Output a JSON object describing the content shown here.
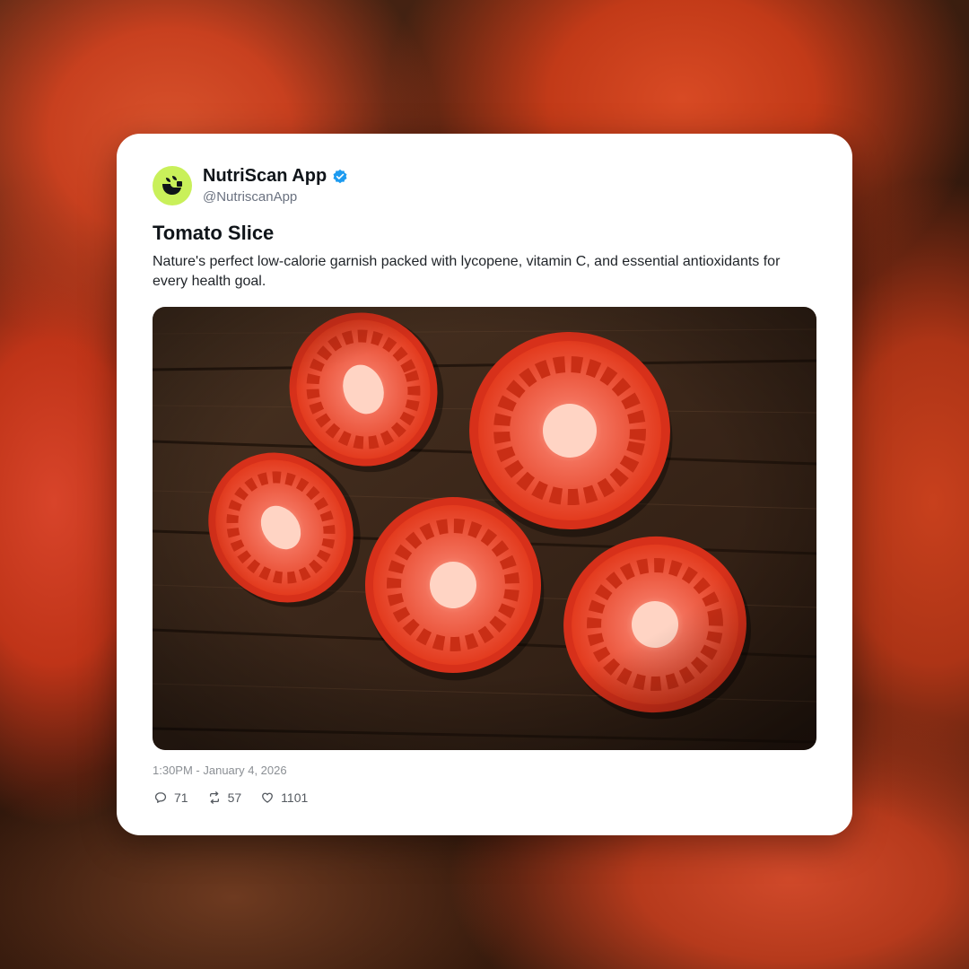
{
  "post": {
    "author_name": "NutriScan App",
    "handle": "@NutriscanApp",
    "title": "Tomato Slice",
    "body": "Nature's perfect low-calorie garnish packed with lycopene, vitamin C, and essential antioxidants for every health goal.",
    "timestamp": "1:30PM - January 4, 2026",
    "replies": "71",
    "reposts": "57",
    "likes": "1101"
  },
  "icons": {
    "avatar": "nutriscan-logo-icon",
    "verified": "verified-badge-icon",
    "reply": "reply-icon",
    "repost": "repost-icon",
    "like": "heart-icon"
  },
  "colors": {
    "avatar_bg": "#c9f05a",
    "verified": "#1d9bf0",
    "tomato": "#e23a1c",
    "wood": "#3d281a"
  }
}
